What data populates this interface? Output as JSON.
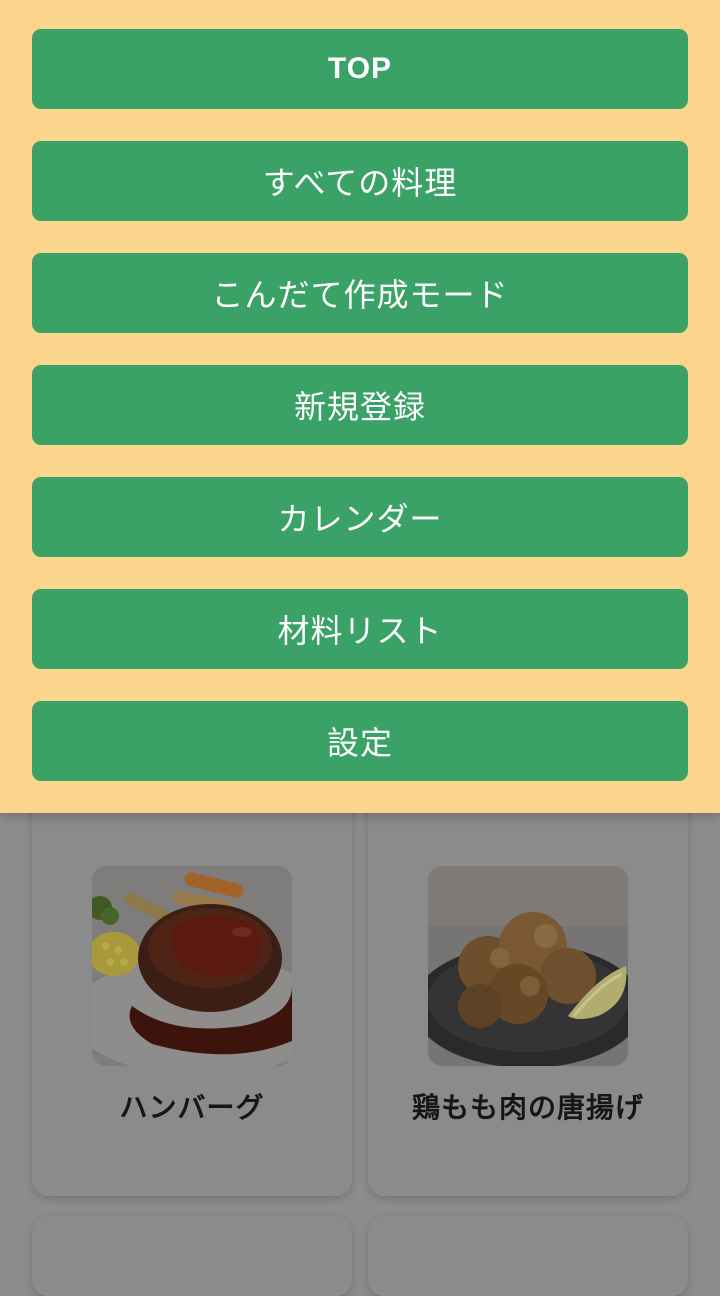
{
  "menu": {
    "items": [
      {
        "label": "TOP"
      },
      {
        "label": "すべての料理"
      },
      {
        "label": "こんだて作成モード"
      },
      {
        "label": "新規登録"
      },
      {
        "label": "カレンダー"
      },
      {
        "label": "材料リスト"
      },
      {
        "label": "設定"
      }
    ]
  },
  "recipes": [
    {
      "name": "ハンバーグ",
      "image_icon": "hamburg-steak-photo"
    },
    {
      "name": "鶏もも肉の唐揚げ",
      "image_icon": "fried-chicken-photo"
    }
  ],
  "colors": {
    "menu_background": "#fcd58d",
    "button": "#3aa267",
    "button_text": "#ffffff",
    "dim_overlay": "#8c8c8c"
  }
}
